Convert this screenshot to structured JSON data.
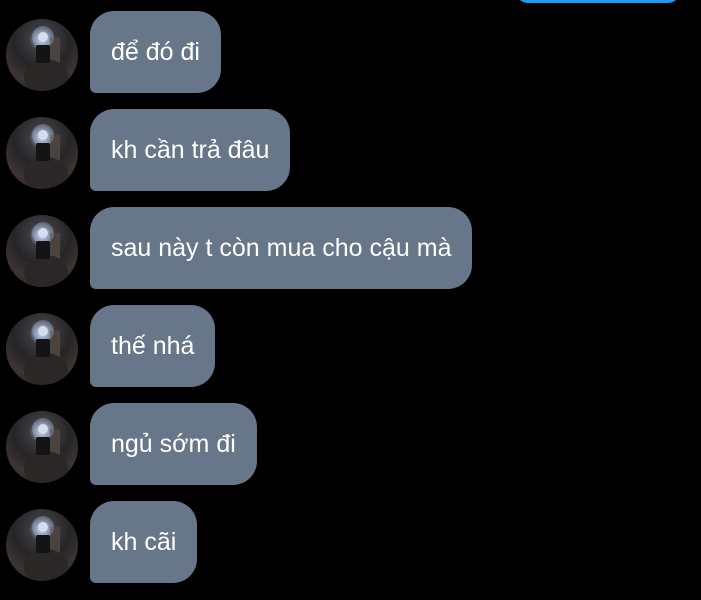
{
  "theme": {
    "background": "#000000",
    "received_bubble": "#677789",
    "sent_bubble": "#1d9bf0",
    "text": "#ffffff"
  },
  "conversation": {
    "messages": [
      {
        "sender": "contact",
        "avatar_icon": "profile-photo-icon",
        "text": "để đó đi"
      },
      {
        "sender": "contact",
        "avatar_icon": "profile-photo-icon",
        "text": "kh cần trả đâu"
      },
      {
        "sender": "contact",
        "avatar_icon": "profile-photo-icon",
        "text": "sau này t còn mua cho cậu mà"
      },
      {
        "sender": "contact",
        "avatar_icon": "profile-photo-icon",
        "text": "thế nhá"
      },
      {
        "sender": "contact",
        "avatar_icon": "profile-photo-icon",
        "text": "ngủ sớm đi"
      },
      {
        "sender": "contact",
        "avatar_icon": "profile-photo-icon",
        "text": "kh cãi"
      }
    ]
  }
}
